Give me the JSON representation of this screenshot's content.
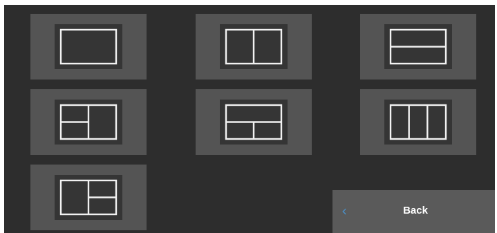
{
  "layout_options": [
    {
      "id": "single",
      "icon": "layout-single-icon"
    },
    {
      "id": "split-vertical",
      "icon": "layout-split-vertical-icon"
    },
    {
      "id": "split-horizontal",
      "icon": "layout-split-horizontal-icon"
    },
    {
      "id": "left-two-stacked-right-one",
      "icon": "layout-left-stacked-right-single-icon"
    },
    {
      "id": "top-one-bottom-two",
      "icon": "layout-top-single-bottom-split-icon"
    },
    {
      "id": "three-columns",
      "icon": "layout-three-columns-icon"
    },
    {
      "id": "left-one-right-two-stacked",
      "icon": "layout-left-single-right-stacked-icon"
    }
  ],
  "back_button": {
    "label": "Back",
    "icon": "chevron-left-icon"
  },
  "colors": {
    "background": "#2d2d2d",
    "tile": "#545454",
    "tile_inner": "#353535",
    "outline": "#f2f2f2",
    "back_button": "#5a5a5a",
    "chevron": "#4a90c8"
  }
}
